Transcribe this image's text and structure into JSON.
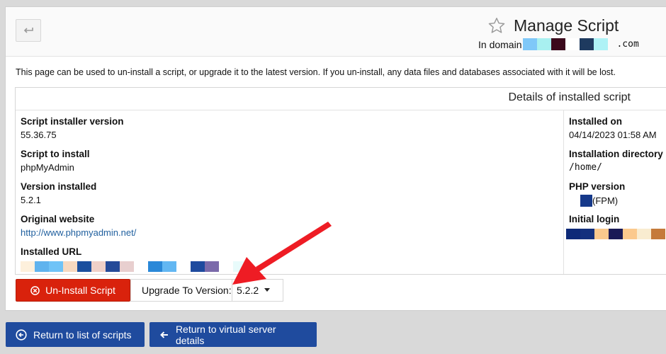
{
  "header": {
    "title": "Manage Script",
    "domain_prefix": "In domain",
    "domain_suffix": ".com"
  },
  "description": "This page can be used to un-install a script, or upgrade it to the latest version. If you un-install, any data files and databases associated with it will be lost.",
  "details": {
    "title": "Details of installed script",
    "left": [
      {
        "label": "Script installer version",
        "value": "55.36.75"
      },
      {
        "label": "Script to install",
        "value": "phpMyAdmin"
      },
      {
        "label": "Version installed",
        "value": "5.2.1"
      },
      {
        "label": "Original website",
        "value": "http://www.phpmyadmin.net/"
      },
      {
        "label": "Installed URL",
        "value": ""
      }
    ],
    "right": [
      {
        "label": "Installed on",
        "value": "04/14/2023 01:58 AM"
      },
      {
        "label": "Installation directory",
        "value": "/home/"
      },
      {
        "label": "PHP version",
        "value": "(FPM)"
      },
      {
        "label": "Initial login",
        "value": ""
      }
    ]
  },
  "actions": {
    "uninstall_label": "Un-Install Script",
    "upgrade_label": "Upgrade To Version:",
    "upgrade_selected": "5.2.2"
  },
  "bottom": {
    "return_scripts": "Return to list of scripts",
    "return_server": "Return to virtual server details"
  },
  "colors": {
    "danger": "#d9220c",
    "primary": "#1f4b9e",
    "link": "#1f5f9e",
    "annotation_arrow": "#ee1c24"
  },
  "icons": {
    "back": "return-arrow-icon",
    "favorite": "star-outline-icon",
    "uninstall": "circle-x-icon",
    "select": "caret-down-icon",
    "return_scripts": "circle-arrow-left-icon",
    "return_server": "arrow-left-icon"
  }
}
